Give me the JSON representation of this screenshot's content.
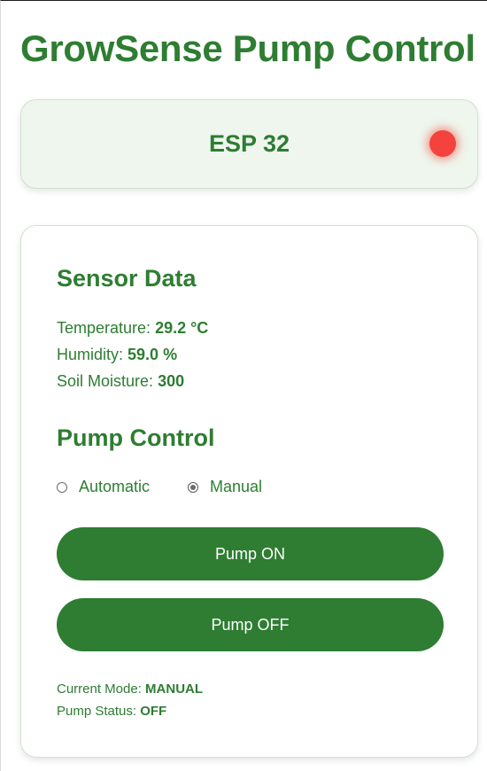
{
  "page": {
    "title": "GrowSense Pump Control"
  },
  "device": {
    "name": "ESP 32",
    "status_color": "#f4433c"
  },
  "sensor": {
    "heading": "Sensor Data",
    "temperature": {
      "label": "Temperature:",
      "value": "29.2 °C"
    },
    "humidity": {
      "label": "Humidity:",
      "value": "59.0 %"
    },
    "soil_moisture": {
      "label": "Soil Moisture:",
      "value": "300"
    }
  },
  "pump": {
    "heading": "Pump Control",
    "modes": [
      {
        "label": "Automatic",
        "selected": false
      },
      {
        "label": "Manual",
        "selected": true
      }
    ],
    "on_label": "Pump ON",
    "off_label": "Pump OFF",
    "current_mode": {
      "label": "Current Mode:",
      "value": "MANUAL"
    },
    "pump_status": {
      "label": "Pump Status:",
      "value": "OFF"
    }
  },
  "colors": {
    "accent": "#2e7d32",
    "device_card_bg": "#eef6ee",
    "status_dot": "#f4433c"
  }
}
